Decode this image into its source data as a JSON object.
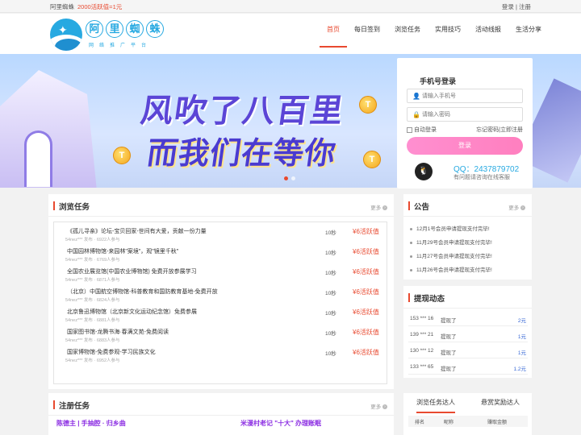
{
  "topbar": {
    "brand": "阿里蜘蛛",
    "promo": "2000活跃值=1元",
    "login": "登录",
    "sep": "|",
    "register": "注册"
  },
  "logo": {
    "chars": [
      "阿",
      "里",
      "蜘",
      "蛛"
    ],
    "sub": "网络推广平台"
  },
  "nav": [
    {
      "label": "首页",
      "active": true
    },
    {
      "label": "每日签到"
    },
    {
      "label": "浏览任务"
    },
    {
      "label": "实用技巧"
    },
    {
      "label": "活动线报"
    },
    {
      "label": "生活分享"
    }
  ],
  "banner": {
    "line1": "风吹了八百里",
    "line2": "而我们在等你",
    "coin_glyph": "T"
  },
  "login": {
    "title": "手机号登录",
    "phone_placeholder": "请输入手机号",
    "password_placeholder": "请输入密码",
    "auto_login": "自动登录",
    "forgot": "忘记密码",
    "divider": "|",
    "register_now": "立即注册",
    "submit": "登录",
    "qq_number": "QQ：2437879702",
    "qq_tip": "有问题请咨询在线客服"
  },
  "browse": {
    "title": "浏览任务",
    "more": "更多",
    "tasks": [
      {
        "name": "《孤儿寻亲》论坛-宝贝回家-世间有大爱，贡献一份力量",
        "meta": "54nez*** 发布 · 6922人参与",
        "sec": "10秒",
        "reward": "¥6活跃值"
      },
      {
        "name": "中国园林博物馆-来园林\"案境\"，观\"镜里千秋\"",
        "meta": "54nez*** 发布 · 6769人参与",
        "sec": "10秒",
        "reward": "¥6活跃值"
      },
      {
        "name": "全国农业展览馆(中国农业博物馆) 免费开放参展学习",
        "meta": "54nez*** 发布 · 6871人参与",
        "sec": "10秒",
        "reward": "¥6活跃值"
      },
      {
        "name": "（北京）中国航空博物馆-科普教育和国防教育基地-免费开放",
        "meta": "54nez*** 发布 · 6824人参与",
        "sec": "10秒",
        "reward": "¥6活跃值"
      },
      {
        "name": "北京鲁迅博物馆（北京新文化运动纪念馆）免费参展",
        "meta": "54nez*** 发布 · 6881人参与",
        "sec": "10秒",
        "reward": "¥6活跃值"
      },
      {
        "name": "国家图书馆-龙腾书海·春满文苑-免费阅读",
        "meta": "54nez*** 发布 · 6883人参与",
        "sec": "10秒",
        "reward": "¥6活跃值"
      },
      {
        "name": "国家博物馆-免费参观-学习民族文化",
        "meta": "54nez*** 发布 · 6952人参与",
        "sec": "10秒",
        "reward": "¥6活跃值"
      }
    ]
  },
  "notice": {
    "title": "公告",
    "more": "更多",
    "items": [
      "12月1号会员申请提现支付完毕!",
      "11月29号会员申请提现支付完毕!",
      "11月27号会员申请提现支付完毕!",
      "11月26号会员申请提现支付完毕!"
    ]
  },
  "withdraw": {
    "title": "提现动态",
    "rows": [
      {
        "user": "153 *** 16",
        "action": "提现了",
        "amount": "2元"
      },
      {
        "user": "139 *** 21",
        "action": "提现了",
        "amount": "1元"
      },
      {
        "user": "130 *** 12",
        "action": "提现了",
        "amount": "1元"
      },
      {
        "user": "133 *** 65",
        "action": "提现了",
        "amount": "1.2元"
      }
    ]
  },
  "register_tasks": {
    "title": "注册任务",
    "more": "更多",
    "items": [
      "陈德主 | 手抽腔 · 归乡曲",
      "米漫村老记 \"十大\" 办理账眠"
    ]
  },
  "ranking": {
    "tab1": "浏览任务达人",
    "tab2": "悬赏奖励达人",
    "headers": [
      "排名",
      "昵称",
      "赚取金额"
    ]
  },
  "colors": {
    "accent": "#e8492f",
    "brand_blue": "#27a9e1",
    "login_button": "#ff85c6"
  }
}
